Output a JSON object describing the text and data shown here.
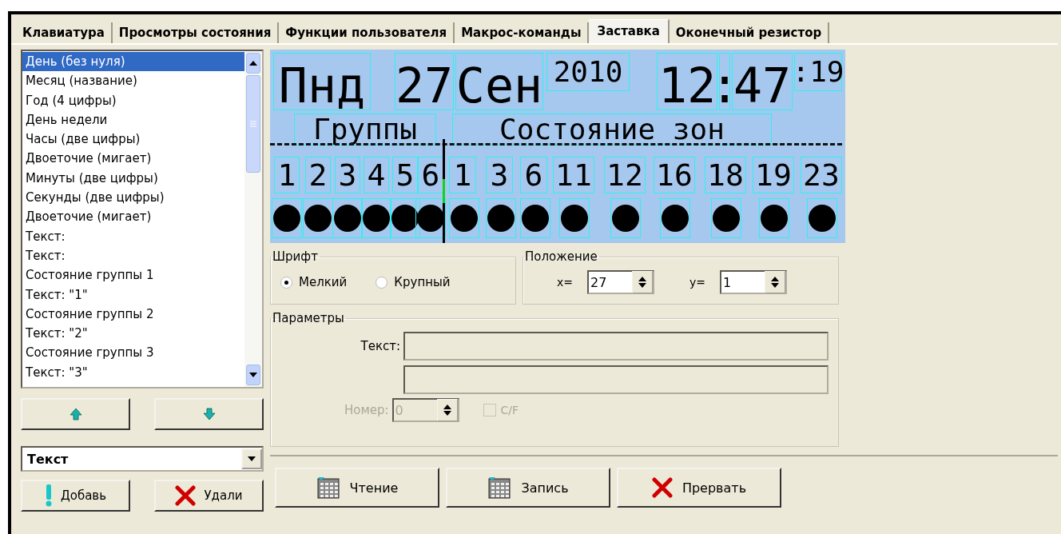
{
  "tabs": [
    {
      "label": "Клавиатура",
      "selected": false
    },
    {
      "label": "Просмотры состояния",
      "selected": false
    },
    {
      "label": "Функции пользователя",
      "selected": false
    },
    {
      "label": "Макрос-команды",
      "selected": false
    },
    {
      "label": "Заставка",
      "selected": true
    },
    {
      "label": "Оконечный резистор",
      "selected": false
    }
  ],
  "element_list": {
    "items": [
      {
        "label": "День (без нуля)",
        "selected": true
      },
      {
        "label": "Месяц (название)",
        "selected": false
      },
      {
        "label": "Год (4 цифры)",
        "selected": false
      },
      {
        "label": "День недели",
        "selected": false
      },
      {
        "label": "Часы (две цифры)",
        "selected": false
      },
      {
        "label": "Двоеточие (мигает)",
        "selected": false
      },
      {
        "label": "Минуты (две цифры)",
        "selected": false
      },
      {
        "label": "Секунды (две цифры)",
        "selected": false
      },
      {
        "label": "Двоеточие (мигает)",
        "selected": false
      },
      {
        "label": "Текст:",
        "selected": false
      },
      {
        "label": "Текст:",
        "selected": false
      },
      {
        "label": "Состояние группы 1",
        "selected": false
      },
      {
        "label": "Текст: \"1\"",
        "selected": false
      },
      {
        "label": "Состояние группы 2",
        "selected": false
      },
      {
        "label": "Текст: \"2\"",
        "selected": false
      },
      {
        "label": "Состояние группы 3",
        "selected": false
      },
      {
        "label": "Текст: \"3\"",
        "selected": false
      }
    ]
  },
  "element_type": {
    "value": "Текст"
  },
  "add_button": "Добавь",
  "delete_button": "Удали",
  "lcd": {
    "top_row": [
      {
        "text": "Пнд",
        "kind": "big"
      },
      {
        "text": "27",
        "kind": "big"
      },
      {
        "text": "Сен",
        "kind": "big"
      },
      {
        "text": "2010",
        "kind": "small"
      },
      {
        "text": "12",
        "kind": "big"
      },
      {
        "text": ":",
        "kind": "big"
      },
      {
        "text": "47",
        "kind": "big"
      },
      {
        "text": ":19",
        "kind": "small"
      }
    ],
    "groups_label": "Группы",
    "zones_label": "Состояние зон",
    "group_numbers": [
      "1",
      "2",
      "3",
      "4",
      "5",
      "6"
    ],
    "zone_numbers": [
      "1",
      "3",
      "6",
      "11",
      "12",
      "16",
      "18",
      "19",
      "23"
    ]
  },
  "font": {
    "title": "Шрифт",
    "options": [
      {
        "label": "Мелкий",
        "selected": true
      },
      {
        "label": "Крупный",
        "selected": false
      }
    ]
  },
  "position": {
    "title": "Положение",
    "x_label": "x=",
    "x_value": "27",
    "y_label": "y=",
    "y_value": "1"
  },
  "parameters": {
    "title": "Параметры",
    "disabled": true,
    "text_label": "Текст:",
    "number_label": "Номер:",
    "number_value": "0",
    "cf_label": "C/F",
    "cf_checked": false
  },
  "actions": [
    {
      "label": "Чтение",
      "kind": "read"
    },
    {
      "label": "Запись",
      "kind": "write"
    },
    {
      "label": "Прервать",
      "kind": "abort"
    }
  ]
}
